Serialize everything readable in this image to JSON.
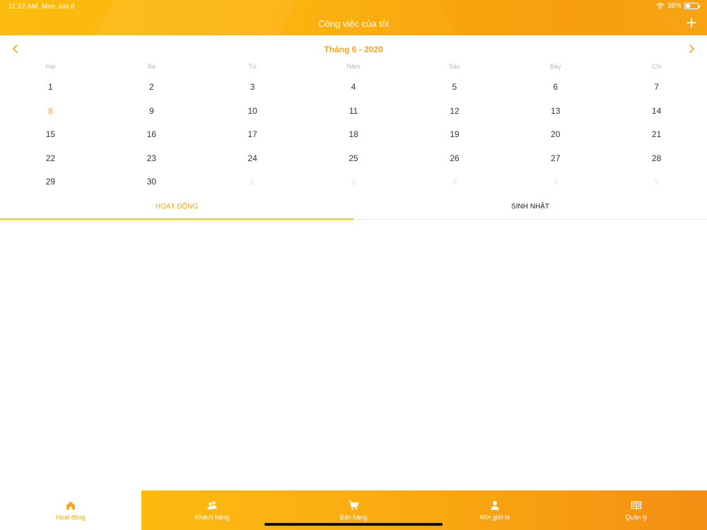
{
  "status_bar": {
    "time": "11:22 AM",
    "date": "Mon Jun 8",
    "battery": "38%",
    "battery_level": 0.38
  },
  "header": {
    "title": "Công việc của tôi",
    "add_icon": "plus-icon"
  },
  "calendar": {
    "month_label": "Tháng 6 - 2020",
    "weekdays": [
      "Hai",
      "Ba",
      "Tư",
      "Năm",
      "Sáu",
      "Bảy",
      "CN"
    ],
    "weeks": [
      [
        "1",
        "2",
        "3",
        "4",
        "5",
        "6",
        "7"
      ],
      [
        "8",
        "9",
        "10",
        "11",
        "12",
        "13",
        "14"
      ],
      [
        "15",
        "16",
        "17",
        "18",
        "19",
        "20",
        "21"
      ],
      [
        "22",
        "23",
        "24",
        "25",
        "26",
        "27",
        "28"
      ],
      [
        "29",
        "30",
        "1",
        "2",
        "3",
        "4",
        "5"
      ]
    ],
    "today": "8"
  },
  "tabs": {
    "activity": "HOẠT ĐỘNG",
    "birthday": "SINH NHẬT"
  },
  "tabbar": {
    "items": [
      {
        "label": "Hoạt động",
        "icon": "home-icon"
      },
      {
        "label": "Khách hàng",
        "icon": "customers-icon"
      },
      {
        "label": "Bán hàng",
        "icon": "cart-icon"
      },
      {
        "label": "Mời giới lé",
        "icon": "person-icon"
      },
      {
        "label": "Quản lý",
        "icon": "book-icon"
      }
    ]
  },
  "colors": {
    "accent": "#f5a623",
    "header_start": "#fcbc0e",
    "header_end": "#f7a313",
    "tab_underline": "#f5c518"
  }
}
